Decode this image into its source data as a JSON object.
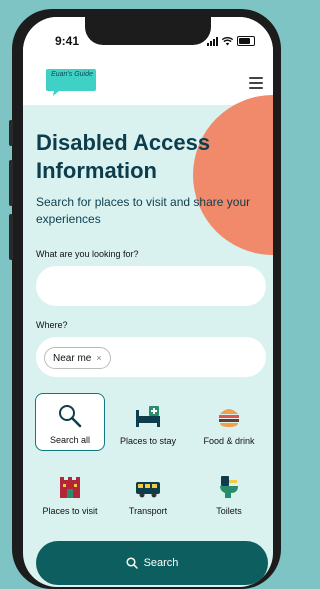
{
  "status_bar": {
    "time": "9:41"
  },
  "header": {
    "logo_text": "Euan's Guide",
    "menu_icon": "hamburger-icon"
  },
  "hero": {
    "title": "Disabled Access Information",
    "subtitle": "Search for places to visit and share your experiences"
  },
  "search": {
    "what_label": "What are you looking for?",
    "what_value": "",
    "where_label": "Where?",
    "where_chip": "Near me",
    "where_chip_remove": "×"
  },
  "categories": [
    {
      "label": "Search all",
      "icon": "magnifier-icon",
      "selected": true
    },
    {
      "label": "Places to stay",
      "icon": "bed-icon",
      "selected": false
    },
    {
      "label": "Food & drink",
      "icon": "burger-icon",
      "selected": false
    },
    {
      "label": "Places to visit",
      "icon": "castle-icon",
      "selected": false
    },
    {
      "label": "Transport",
      "icon": "bus-icon",
      "selected": false
    },
    {
      "label": "Toilets",
      "icon": "toilet-icon",
      "selected": false
    }
  ],
  "search_button": {
    "label": "Search"
  },
  "colors": {
    "accent": "#0d5f5f",
    "background": "#d9f2ef",
    "highlight": "#f08a6a",
    "logo": "#3fd0c6"
  }
}
